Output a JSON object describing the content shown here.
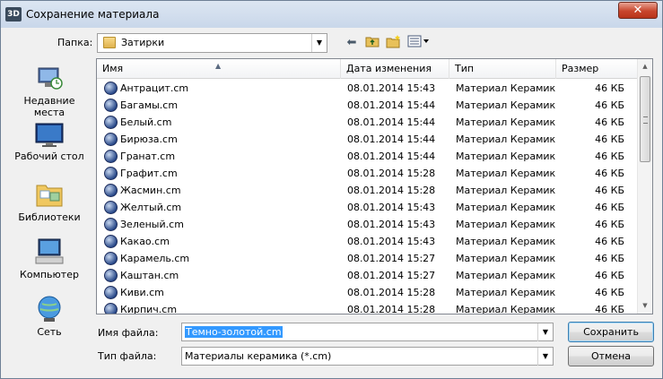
{
  "window": {
    "title": "Сохранение материала",
    "app_icon_text": "3D",
    "close_glyph": "✕"
  },
  "lookin": {
    "label": "Папка:",
    "value": "Затирки"
  },
  "places": [
    {
      "label_line1": "Недавние",
      "label_line2": "места",
      "icon": "recent-places-icon"
    },
    {
      "label_line1": "Рабочий стол",
      "label_line2": "",
      "icon": "desktop-icon"
    },
    {
      "label_line1": "Библиотеки",
      "label_line2": "",
      "icon": "libraries-icon"
    },
    {
      "label_line1": "Компьютер",
      "label_line2": "",
      "icon": "computer-icon"
    },
    {
      "label_line1": "Сеть",
      "label_line2": "",
      "icon": "network-icon"
    }
  ],
  "columns": {
    "name": "Имя",
    "date": "Дата изменения",
    "type": "Тип",
    "size": "Размер"
  },
  "files": [
    {
      "name": "Антрацит.cm",
      "date": "08.01.2014 15:43",
      "type": "Материал Керамик",
      "size": "46 КБ"
    },
    {
      "name": "Багамы.cm",
      "date": "08.01.2014 15:44",
      "type": "Материал Керамик",
      "size": "46 КБ"
    },
    {
      "name": "Белый.cm",
      "date": "08.01.2014 15:44",
      "type": "Материал Керамик",
      "size": "46 КБ"
    },
    {
      "name": "Бирюза.cm",
      "date": "08.01.2014 15:44",
      "type": "Материал Керамик",
      "size": "46 КБ"
    },
    {
      "name": "Гранат.cm",
      "date": "08.01.2014 15:44",
      "type": "Материал Керамик",
      "size": "46 КБ"
    },
    {
      "name": "Графит.cm",
      "date": "08.01.2014 15:28",
      "type": "Материал Керамик",
      "size": "46 КБ"
    },
    {
      "name": "Жасмин.cm",
      "date": "08.01.2014 15:28",
      "type": "Материал Керамик",
      "size": "46 КБ"
    },
    {
      "name": "Желтый.cm",
      "date": "08.01.2014 15:43",
      "type": "Материал Керамик",
      "size": "46 КБ"
    },
    {
      "name": "Зеленый.cm",
      "date": "08.01.2014 15:43",
      "type": "Материал Керамик",
      "size": "46 КБ"
    },
    {
      "name": "Какао.cm",
      "date": "08.01.2014 15:43",
      "type": "Материал Керамик",
      "size": "46 КБ"
    },
    {
      "name": "Карамель.cm",
      "date": "08.01.2014 15:27",
      "type": "Материал Керамик",
      "size": "46 КБ"
    },
    {
      "name": "Каштан.cm",
      "date": "08.01.2014 15:27",
      "type": "Материал Керамик",
      "size": "46 КБ"
    },
    {
      "name": "Киви.cm",
      "date": "08.01.2014 15:28",
      "type": "Материал Керамик",
      "size": "46 КБ"
    },
    {
      "name": "Кирпич.cm",
      "date": "08.01.2014 15:28",
      "type": "Материал Керамик",
      "size": "46 КБ"
    }
  ],
  "filename": {
    "label": "Имя файла:",
    "value": "Темно-золотой.cm"
  },
  "filetype": {
    "label": "Тип файла:",
    "value": "Материалы керамика (*.cm)"
  },
  "buttons": {
    "save": "Сохранить",
    "cancel": "Отмена"
  },
  "colors": {
    "selection": "#3399ff",
    "close_button": "#c8452c"
  }
}
